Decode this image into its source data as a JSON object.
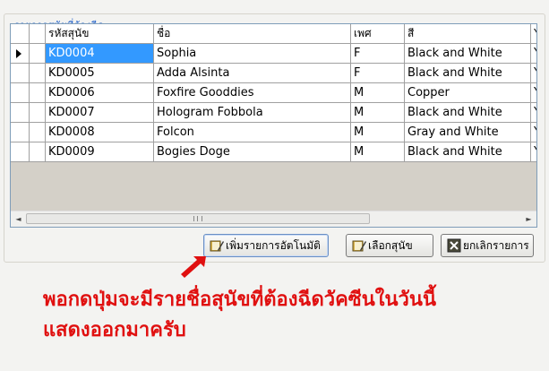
{
  "group": {
    "title": "รายการสุนัขที่ต้องฉีด"
  },
  "grid": {
    "columns": [
      "รหัสสุนัข",
      "ชื่อ",
      "เพศ",
      "สี",
      "Y"
    ],
    "rows": [
      [
        "KD0004",
        "Sophia",
        "F",
        "Black and White",
        "Y"
      ],
      [
        "KD0005",
        "Adda Alsinta",
        "F",
        "Black and White",
        "Y"
      ],
      [
        "KD0006",
        "Foxfire Gooddies",
        "M",
        "Copper",
        "Y"
      ],
      [
        "KD0007",
        "Hologram Fobbola",
        "M",
        "Black and White",
        "Y"
      ],
      [
        "KD0008",
        "Folcon",
        "M",
        "Gray and White",
        "Y"
      ],
      [
        "KD0009",
        "Bogies Doge",
        "M",
        "Black and White",
        "Y"
      ]
    ],
    "selected_row": 0,
    "scroll": {
      "left": "◄",
      "right": "►",
      "grip": "|||"
    }
  },
  "buttons": {
    "auto_add": "เพิ่มรายการอัตโนมัติ",
    "choose_dog": "เลือกสุนัข",
    "cancel": "ยกเลิกรายการ"
  },
  "annotation": {
    "line1": "พอกดปุ่มจะมีรายชื่อสุนัขที่ต้องฉีดวัคซีนในวันนี้",
    "line2": "แสดงออกมาครับ"
  },
  "colors": {
    "accent": "#3399ff",
    "annotation": "#e01010",
    "title": "#1f5fc8"
  }
}
